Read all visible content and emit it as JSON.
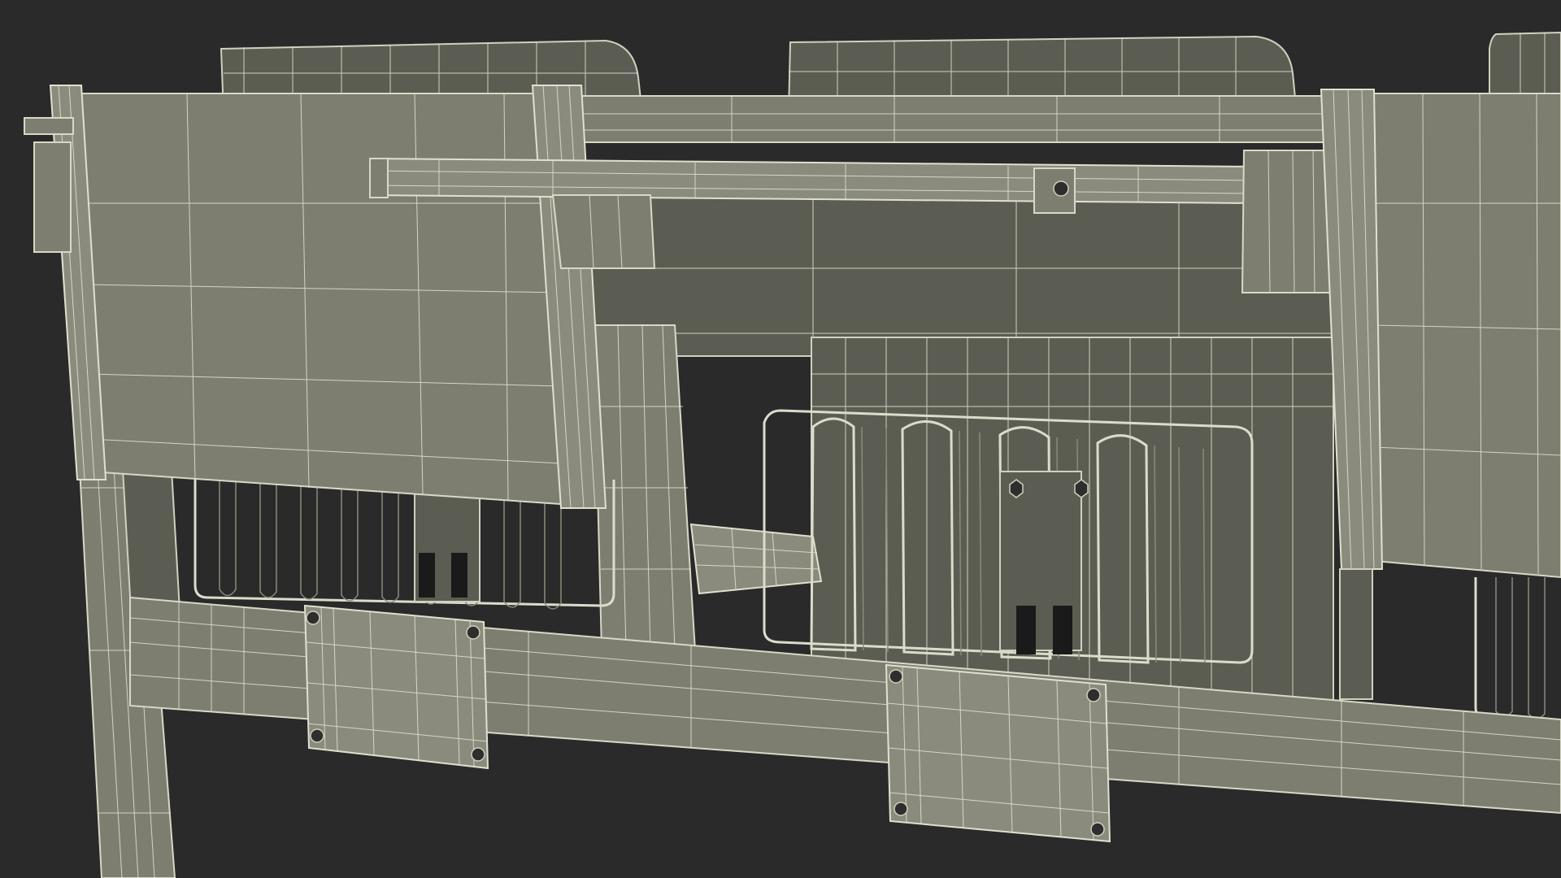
{
  "scene": {
    "background_color": "#2a2a2a",
    "material_color": "#7d7e70",
    "wire_color": "#e4e4d4",
    "render_style": "wireframe-on-shaded"
  },
  "objects": [
    {
      "key": "seat-back-left"
    },
    {
      "key": "seat-back-center"
    },
    {
      "key": "seat-back-right"
    },
    {
      "key": "armrest-panel-left"
    },
    {
      "key": "armrest-panel-right"
    },
    {
      "key": "tablet-shelf"
    },
    {
      "key": "back-rail-upper"
    },
    {
      "key": "back-rail-lower"
    },
    {
      "key": "wire-rack-left"
    },
    {
      "key": "wire-rack-center"
    },
    {
      "key": "wire-rack-right"
    },
    {
      "key": "beam-main"
    },
    {
      "key": "mount-box-left"
    },
    {
      "key": "mount-box-center"
    },
    {
      "key": "leg-left"
    },
    {
      "key": "under-shelf"
    }
  ]
}
